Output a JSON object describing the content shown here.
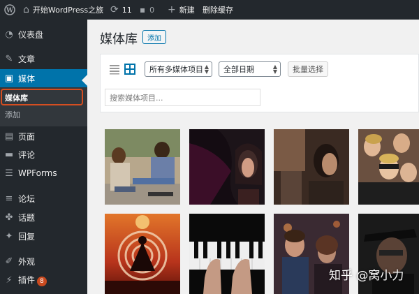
{
  "adminbar": {
    "site_name": "开始WordPress之旅",
    "updates_count": "11",
    "comments_count": "0",
    "new_label": "新建",
    "clear_cache_label": "删除缓存"
  },
  "sidebar": {
    "items": [
      {
        "label": "仪表盘",
        "icon": "dashboard-icon"
      },
      {
        "label": "文章",
        "icon": "pin-icon"
      },
      {
        "label": "媒体",
        "icon": "media-icon"
      },
      {
        "label": "页面",
        "icon": "page-icon"
      },
      {
        "label": "评论",
        "icon": "comment-icon"
      },
      {
        "label": "WPForms",
        "icon": "wpforms-icon"
      },
      {
        "label": "论坛",
        "icon": "forum-icon"
      },
      {
        "label": "话题",
        "icon": "topic-icon"
      },
      {
        "label": "回复",
        "icon": "reply-icon"
      },
      {
        "label": "外观",
        "icon": "appearance-icon"
      },
      {
        "label": "插件",
        "icon": "plugin-icon",
        "badge": "8"
      }
    ],
    "submenu": [
      {
        "label": "媒体库"
      },
      {
        "label": "添加"
      }
    ],
    "accent_color": "#0073aa",
    "highlight_color": "#d54e21"
  },
  "main": {
    "title": "媒体库",
    "add_button": "添加",
    "filter_type": "所有多媒体项目",
    "filter_date": "全部日期",
    "bulk_select": "批量选择",
    "search_placeholder": "搜索媒体项目..."
  },
  "watermark": "知乎 @窝小力"
}
